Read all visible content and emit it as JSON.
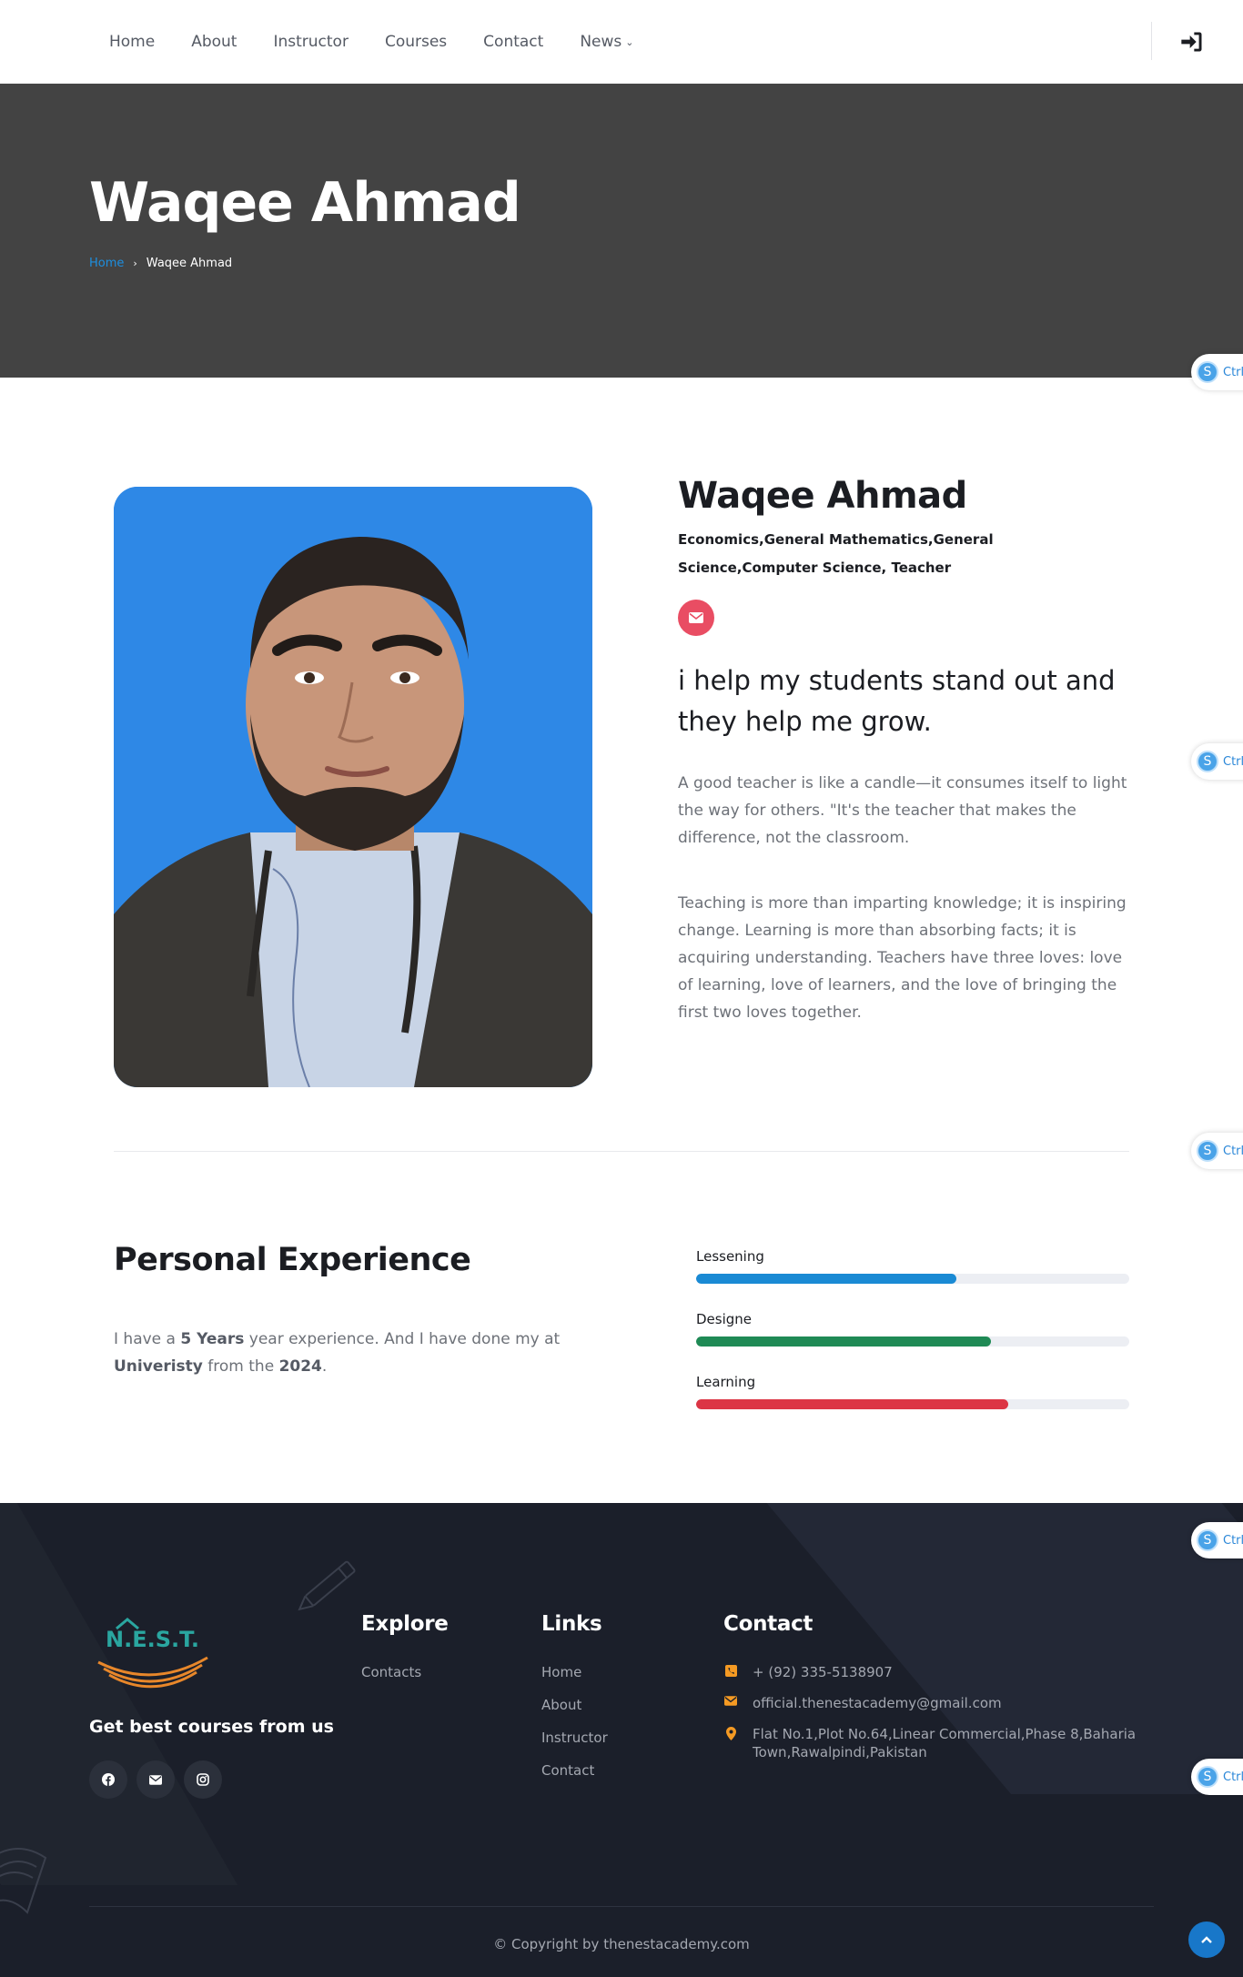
{
  "nav": {
    "links": [
      {
        "label": "Home"
      },
      {
        "label": "About"
      },
      {
        "label": "Instructor"
      },
      {
        "label": "Courses"
      },
      {
        "label": "Contact"
      },
      {
        "label": "News"
      }
    ],
    "login_icon": "sign-in-icon"
  },
  "hero": {
    "title": "Waqee Ahmad",
    "breadcrumb": {
      "home": "Home",
      "separator": "›",
      "current": "Waqee Ahmad"
    }
  },
  "ctrl_badge": {
    "letter": "S",
    "label": "Ctrl"
  },
  "profile": {
    "name": "Waqee Ahmad",
    "subjects": "Economics,General Mathematics,General Science,Computer Science, Teacher",
    "email_icon": "envelope-icon",
    "tagline": "i help my students stand out and they help me grow.",
    "paragraph1": "A good teacher is like a candle—it consumes itself to light the way for others. \"It's the teacher that makes the difference, not the classroom.",
    "paragraph2": "Teaching is more than imparting knowledge; it is inspiring change. Learning is more than absorbing facts; it is acquiring understanding. Teachers have three loves: love of learning, love of learners, and the love of bringing the first two loves together."
  },
  "experience": {
    "title": "Personal Experience",
    "text_parts": {
      "p1": "I have a ",
      "years": "5 Years",
      "p2": " year experience. And I have done my at ",
      "university": "Univeristy",
      "p3": " from the ",
      "year": "2024",
      "p4": "."
    },
    "skills": [
      {
        "label": "Lessening",
        "percent": 60,
        "color": "#1a8ad4"
      },
      {
        "label": "Designe",
        "percent": 68,
        "color": "#1f8a55"
      },
      {
        "label": "Learning",
        "percent": 72,
        "color": "#dc3545"
      }
    ]
  },
  "footer": {
    "tagline": "Get best courses from us",
    "logo_text": "N.E.S.T.",
    "socials": [
      "facebook-icon",
      "envelope-icon",
      "instagram-icon"
    ],
    "explore": {
      "title": "Explore",
      "links": [
        "Contacts"
      ]
    },
    "links": {
      "title": "Links",
      "links": [
        "Home",
        "About",
        "Instructor",
        "Contact"
      ]
    },
    "contact": {
      "title": "Contact",
      "phone": "+ (92) 335-5138907",
      "email": "official.thenestacademy@gmail.com",
      "address": "Flat No.1,Plot No.64,Linear Commercial,Phase 8,Baharia Town,Rawalpindi,Pakistan"
    },
    "copyright": "© Copyright by thenestacademy.com"
  },
  "colors": {
    "hero_bg": "#434343",
    "accent_blue": "#1d8fe0",
    "mail_red": "#e94d63",
    "footer_bg": "#1b1f2a",
    "contact_orange": "#f59a23"
  }
}
